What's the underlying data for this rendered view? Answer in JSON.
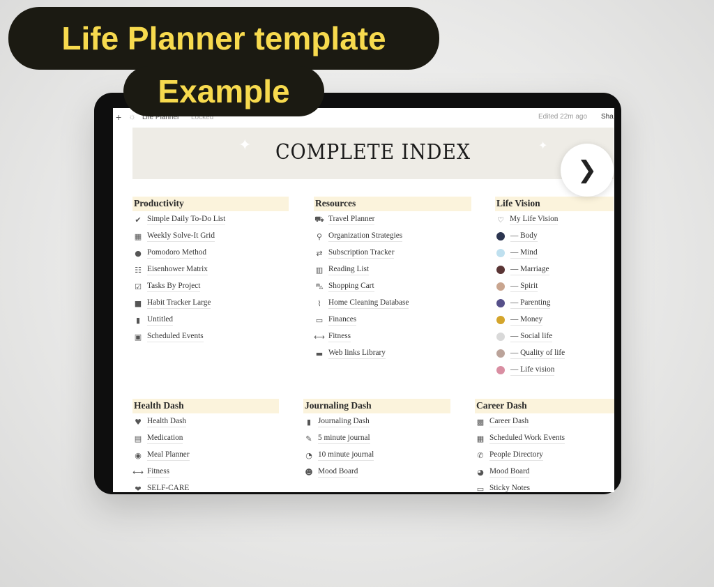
{
  "overlay": {
    "line1": "Life Planner template",
    "line2": "Example",
    "text_color": "#f7da4e",
    "bg_color": "#1b1a12"
  },
  "topbar": {
    "page": "Life Planner",
    "lock": "Locked",
    "edited": "Edited 22m ago",
    "share": "Sha"
  },
  "banner": {
    "title": "COMPLETE INDEX"
  },
  "sections": [
    {
      "title": "Productivity",
      "items": [
        {
          "icon": "check-circle",
          "label": "Simple Daily To-Do List",
          "g": "✔"
        },
        {
          "icon": "grid",
          "label": "Weekly Solve-It Grid",
          "g": "▦"
        },
        {
          "icon": "timer",
          "label": "Pomodoro Method",
          "g": "●"
        },
        {
          "icon": "matrix",
          "label": "Eisenhower Matrix",
          "g": "☷"
        },
        {
          "icon": "checkbox",
          "label": "Tasks By Project",
          "g": "☑"
        },
        {
          "icon": "stack",
          "label": "Habit Tracker Large",
          "g": "■"
        },
        {
          "icon": "bar-chart",
          "label": "Untitled",
          "g": "▮"
        },
        {
          "icon": "calendar",
          "label": "Scheduled Events",
          "g": "▣"
        }
      ]
    },
    {
      "title": "Resources",
      "items": [
        {
          "icon": "luggage",
          "label": "Travel Planner",
          "g": "⛟"
        },
        {
          "icon": "person",
          "label": "Organization Strategies",
          "g": "⚲"
        },
        {
          "icon": "repeat",
          "label": "Subscription Tracker",
          "g": "⇄"
        },
        {
          "icon": "book",
          "label": "Reading List",
          "g": "▥"
        },
        {
          "icon": "cart",
          "label": "Shopping Cart",
          "g": "⛍"
        },
        {
          "icon": "broom",
          "label": "Home Cleaning Database",
          "g": "⌇"
        },
        {
          "icon": "money",
          "label": "Finances",
          "g": "▭"
        },
        {
          "icon": "dumbbell",
          "label": "Fitness",
          "g": "⟷"
        },
        {
          "icon": "laptop",
          "label": "Web links Library",
          "g": "▬"
        }
      ]
    },
    {
      "title": "Life Vision",
      "items": [
        {
          "icon": "heart",
          "label": "My Life Vision",
          "g": "♡"
        },
        {
          "label": "— Body",
          "color": "#2c3550"
        },
        {
          "label": "— Mind",
          "color": "#bfe0ef"
        },
        {
          "label": "— Marriage",
          "color": "#5a3535"
        },
        {
          "label": "— Spirit",
          "color": "#c9a58f"
        },
        {
          "label": "— Parenting",
          "color": "#56508a"
        },
        {
          "label": "— Money",
          "color": "#d4a52c"
        },
        {
          "label": "— Social life",
          "color": "#d9d9d9"
        },
        {
          "label": "— Quality of life",
          "color": "#bba39a"
        },
        {
          "label": "— Life vision",
          "color": "#d98ea2"
        }
      ]
    },
    {
      "title": "Health Dash",
      "items": [
        {
          "icon": "heart-pulse",
          "label": "Health Dash",
          "g": "♥"
        },
        {
          "icon": "pill-bottle",
          "label": "Medication",
          "g": "▤"
        },
        {
          "icon": "plate",
          "label": "Meal Planner",
          "g": "◉"
        },
        {
          "icon": "dumbbell",
          "label": "Fitness",
          "g": "⟷"
        },
        {
          "icon": "heart",
          "label": "SELF-CARE",
          "g": "❤"
        }
      ]
    },
    {
      "title": "Journaling Dash",
      "items": [
        {
          "icon": "notebook",
          "label": "Journaling Dash",
          "g": "▮"
        },
        {
          "icon": "edit",
          "label": "5 minute journal",
          "g": "✎"
        },
        {
          "icon": "clock",
          "label": "10 minute journal",
          "g": "◔"
        },
        {
          "icon": "mood",
          "label": "Mood Board",
          "g": "☻"
        }
      ]
    },
    {
      "title": "Career Dash",
      "items": [
        {
          "icon": "briefcase",
          "label": "Career Dash",
          "g": "▩"
        },
        {
          "icon": "calendar",
          "label": "Scheduled Work Events",
          "g": "▦"
        },
        {
          "icon": "phone",
          "label": "People Directory",
          "g": "✆"
        },
        {
          "icon": "palette",
          "label": "Mood Board",
          "g": "◕"
        },
        {
          "icon": "note",
          "label": "Sticky Notes",
          "g": "▭"
        }
      ]
    }
  ]
}
